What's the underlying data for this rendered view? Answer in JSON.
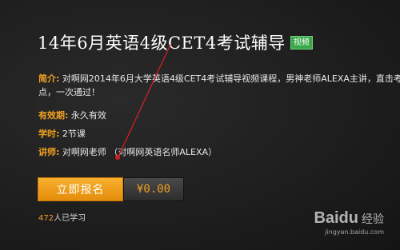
{
  "course": {
    "title": "14年6月英语4级CET4考试辅导",
    "badge": "视频"
  },
  "intro": {
    "label": "简介:",
    "text": "对啊网2014年6月大学英语4级CET4考试辅导视频课程，男神老师ALEXA主讲，直击考点，一次通过！"
  },
  "validity": {
    "label": "有效期:",
    "value": "永久有效"
  },
  "hours": {
    "label": "学时:",
    "value": "2节课"
  },
  "teacher": {
    "label": "讲师:",
    "value": "对啊网老师 （对啊网英语名师ALEXA）"
  },
  "purchase": {
    "button_label": "立即报名",
    "price": "¥0.00"
  },
  "learners": {
    "count": "472",
    "suffix": "人已学习"
  },
  "watermark": {
    "brand": "Baidu",
    "cn": "经验",
    "url": "jingyan.baidu.com"
  },
  "colors": {
    "accent": "#f0a020",
    "badge": "#3aa84a",
    "annotation": "#d22020"
  }
}
